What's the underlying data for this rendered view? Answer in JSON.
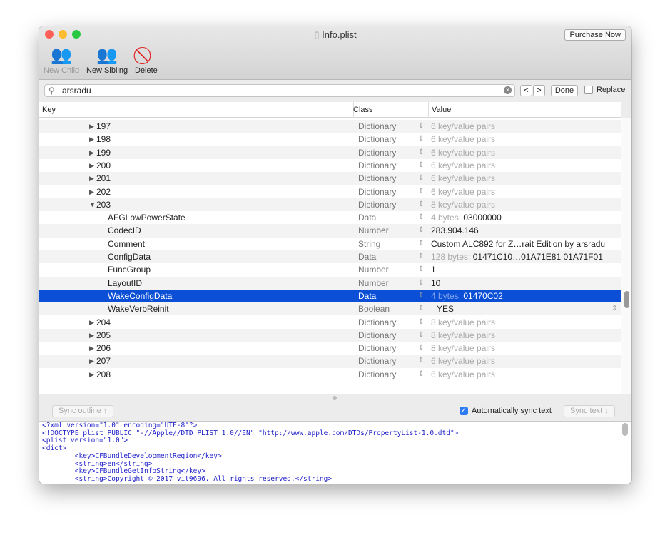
{
  "window": {
    "title": "Info.plist",
    "purchase_label": "Purchase Now"
  },
  "toolbar": {
    "new_child": "New Child",
    "new_sibling": "New Sibling",
    "delete": "Delete"
  },
  "search": {
    "value": "arsradu",
    "prev": "<",
    "next": ">",
    "done": "Done",
    "replace": "Replace"
  },
  "columns": {
    "key": "Key",
    "class": "Class",
    "value": "Value"
  },
  "rows": [
    {
      "key": "197",
      "level": 0,
      "disclosure": "collapsed",
      "class": "Dictionary",
      "dim": "6 key/value pairs",
      "value": ""
    },
    {
      "key": "198",
      "level": 0,
      "disclosure": "collapsed",
      "class": "Dictionary",
      "dim": "6 key/value pairs",
      "value": ""
    },
    {
      "key": "199",
      "level": 0,
      "disclosure": "collapsed",
      "class": "Dictionary",
      "dim": "6 key/value pairs",
      "value": ""
    },
    {
      "key": "200",
      "level": 0,
      "disclosure": "collapsed",
      "class": "Dictionary",
      "dim": "6 key/value pairs",
      "value": ""
    },
    {
      "key": "201",
      "level": 0,
      "disclosure": "collapsed",
      "class": "Dictionary",
      "dim": "6 key/value pairs",
      "value": ""
    },
    {
      "key": "202",
      "level": 0,
      "disclosure": "collapsed",
      "class": "Dictionary",
      "dim": "6 key/value pairs",
      "value": ""
    },
    {
      "key": "203",
      "level": 0,
      "disclosure": "expanded",
      "class": "Dictionary",
      "dim": "8 key/value pairs",
      "value": ""
    },
    {
      "key": "AFGLowPowerState",
      "level": 1,
      "class": "Data",
      "dim": "4 bytes:",
      "value": "03000000"
    },
    {
      "key": "CodecID",
      "level": 1,
      "class": "Number",
      "dim": "",
      "value": "283.904.146"
    },
    {
      "key": "Comment",
      "level": 1,
      "class": "String",
      "dim": "",
      "value": "Custom ALC892 for Z…rait Edition by arsradu"
    },
    {
      "key": "ConfigData",
      "level": 1,
      "class": "Data",
      "dim": "128 bytes:",
      "value": "01471C10…01A71E81 01A71F01"
    },
    {
      "key": "FuncGroup",
      "level": 1,
      "class": "Number",
      "dim": "",
      "value": "1"
    },
    {
      "key": "LayoutID",
      "level": 1,
      "class": "Number",
      "dim": "",
      "value": "10"
    },
    {
      "key": "WakeConfigData",
      "level": 1,
      "class": "Data",
      "dim": "4 bytes:",
      "value": "01470C02",
      "selected": true
    },
    {
      "key": "WakeVerbReinit",
      "level": 1,
      "class": "Boolean",
      "dim": "",
      "value": "YES",
      "popup": true
    },
    {
      "key": "204",
      "level": 0,
      "disclosure": "collapsed",
      "class": "Dictionary",
      "dim": "8 key/value pairs",
      "value": ""
    },
    {
      "key": "205",
      "level": 0,
      "disclosure": "collapsed",
      "class": "Dictionary",
      "dim": "8 key/value pairs",
      "value": ""
    },
    {
      "key": "206",
      "level": 0,
      "disclosure": "collapsed",
      "class": "Dictionary",
      "dim": "8 key/value pairs",
      "value": ""
    },
    {
      "key": "207",
      "level": 0,
      "disclosure": "collapsed",
      "class": "Dictionary",
      "dim": "6 key/value pairs",
      "value": ""
    },
    {
      "key": "208",
      "level": 0,
      "disclosure": "collapsed",
      "class": "Dictionary",
      "dim": "6 key/value pairs",
      "value": ""
    }
  ],
  "lower": {
    "sync_outline": "Sync outline ↑",
    "auto_sync": "Automatically sync text",
    "auto_sync_checked": true,
    "sync_text": "Sync text ↓"
  },
  "xml_lines": [
    "<?xml version=\"1.0\" encoding=\"UTF-8\"?>",
    "<!DOCTYPE plist PUBLIC \"-//Apple//DTD PLIST 1.0//EN\" \"http://www.apple.com/DTDs/PropertyList-1.0.dtd\">",
    "<plist version=\"1.0\">",
    "<dict>",
    "\t<key>CFBundleDevelopmentRegion</key>",
    "\t<string>en</string>",
    "\t<key>CFBundleGetInfoString</key>",
    "\t<string>Copyright © 2017 vit9696. All rights reserved.</string>"
  ]
}
